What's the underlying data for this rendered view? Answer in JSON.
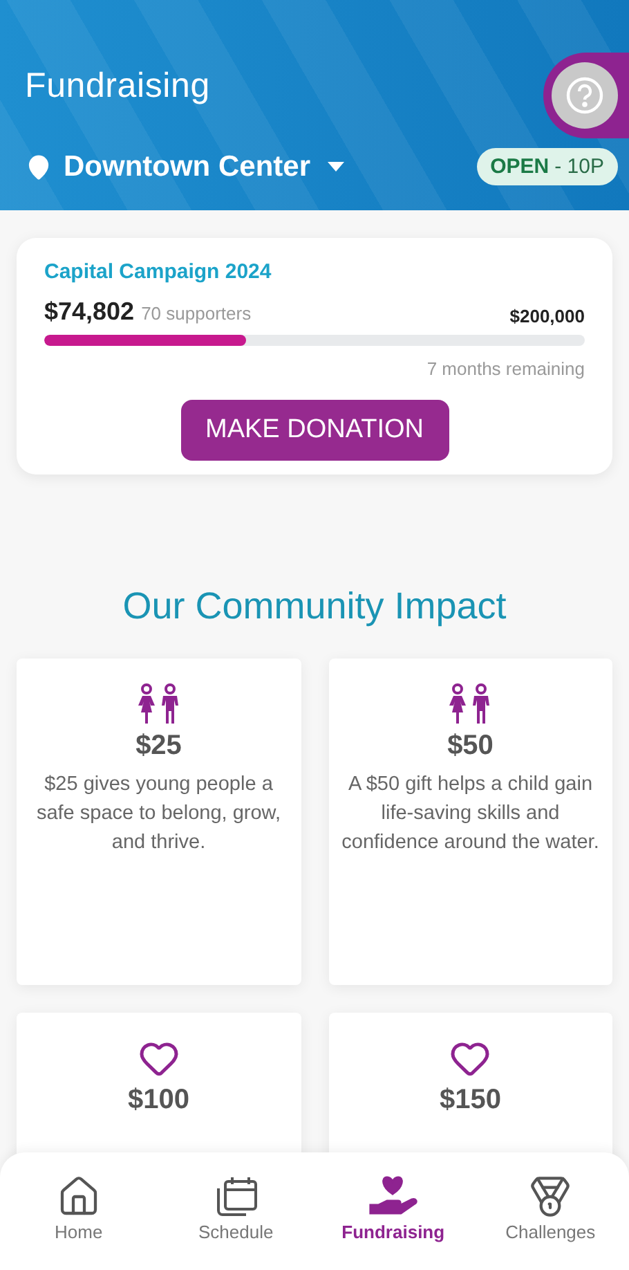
{
  "header": {
    "title": "Fundraising",
    "location": "Downtown Center",
    "status": "OPEN",
    "hours": "- 10P"
  },
  "campaign": {
    "title": "Capital Campaign 2024",
    "raised": "$74,802",
    "supporters": "70 supporters",
    "goal": "$200,000",
    "level": 0.374,
    "remaining": "7 months remaining",
    "button": "MAKE DONATION"
  },
  "impact": {
    "heading": "Our Community Impact",
    "cards": [
      {
        "kind": "people",
        "amount": "$25",
        "text": "$25 gives young people a safe space to belong, grow, and thrive."
      },
      {
        "kind": "people",
        "amount": "$50",
        "text": "A $50 gift helps a child gain life-saving skills and confidence around the water."
      },
      {
        "kind": "heart",
        "amount": "$100"
      },
      {
        "kind": "heart",
        "amount": "$150"
      }
    ]
  },
  "nav": [
    {
      "kind": "home",
      "label": "Home",
      "selected": false
    },
    {
      "kind": "schedule",
      "label": "Schedule",
      "selected": false
    },
    {
      "kind": "fundraising",
      "label": "Fundraising",
      "selected": true
    },
    {
      "kind": "challenges",
      "label": "Challenges",
      "selected": false
    }
  ]
}
